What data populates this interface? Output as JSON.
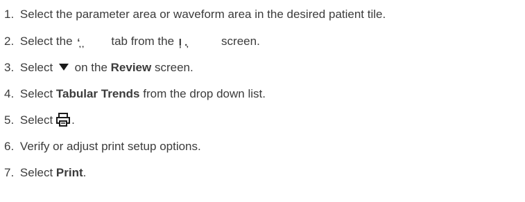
{
  "steps": [
    {
      "number": "1.",
      "text": "Select the parameter area or waveform area in the desired patient tile."
    },
    {
      "number": "2.",
      "text_a": "Select the",
      "artifact_a": "ʻ̦ ̦",
      "text_b": "tab from the",
      "artifact_b": "I̦ .̦",
      "text_c": "screen."
    },
    {
      "number": "3.",
      "text_a": "Select",
      "icon": "dropdown-triangle-icon",
      "text_b": "on the",
      "bold": "Review",
      "text_c": "screen."
    },
    {
      "number": "4.",
      "text_a": "Select",
      "bold": "Tabular Trends",
      "text_b": "from the drop down list."
    },
    {
      "number": "5.",
      "text_a": "Select",
      "icon": "printer-icon",
      "text_b": "."
    },
    {
      "number": "6.",
      "text": "Verify or adjust print setup options."
    },
    {
      "number": "7.",
      "text_a": "Select",
      "bold": "Print",
      "text_b": "."
    }
  ]
}
